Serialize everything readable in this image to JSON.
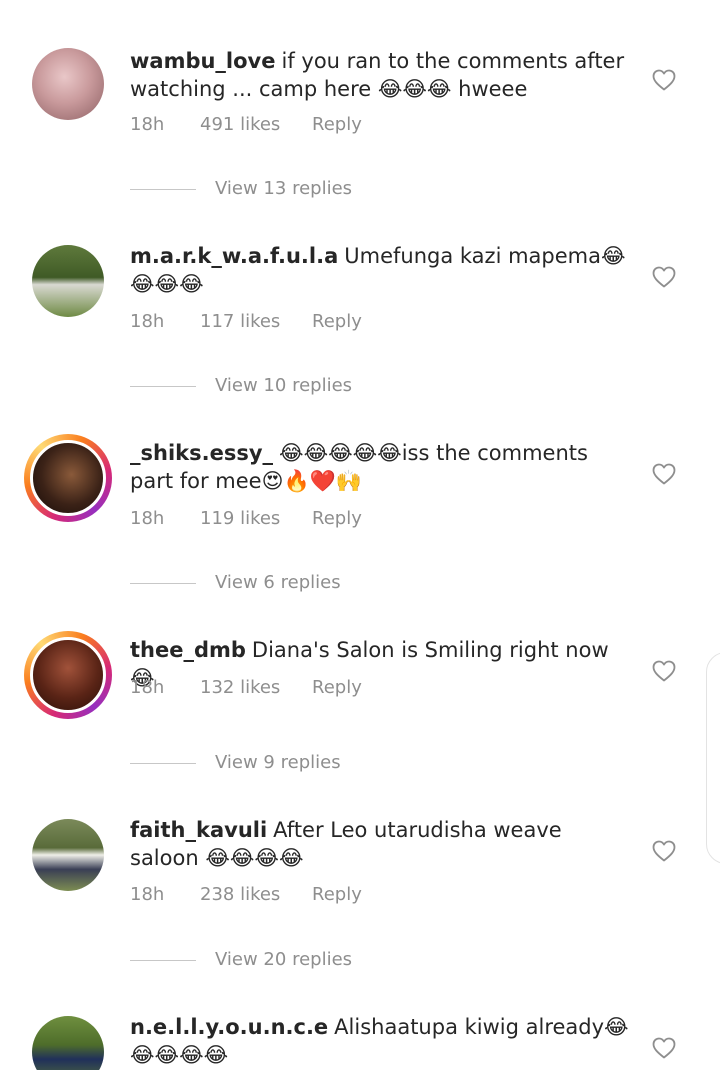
{
  "comments": [
    {
      "username": "wambu_love",
      "text": "if you ran to the comments after watching ... camp here 😂😂😂 hweee",
      "time": "18h",
      "likes": "491 likes",
      "reply_label": "Reply",
      "view_replies": "View 13 replies",
      "avatar_style": "plain"
    },
    {
      "username": "m.a.r.k_w.a.f.u.l.a",
      "text": "Umefunga kazi mapema😂😂😂😂",
      "time": "18h",
      "likes": "117 likes",
      "reply_label": "Reply",
      "view_replies": "View 10 replies",
      "avatar_style": "plain"
    },
    {
      "username": "_shiks.essy_",
      "text": "😂😂😂😂😂iss the comments part for mee😍🔥❤️🙌",
      "time": "18h",
      "likes": "119 likes",
      "reply_label": "Reply",
      "view_replies": "View 6 replies",
      "avatar_style": "story-ring"
    },
    {
      "username": "thee_dmb",
      "text": "Diana's Salon is Smiling right now 😂",
      "time": "18h",
      "likes": "132 likes",
      "reply_label": "Reply",
      "view_replies": "View 9 replies",
      "avatar_style": "story-ring"
    },
    {
      "username": "faith_kavuli",
      "text": "After Leo utarudisha weave saloon 😂😂😂😂",
      "time": "18h",
      "likes": "238 likes",
      "reply_label": "Reply",
      "view_replies": "View 20 replies",
      "avatar_style": "plain"
    },
    {
      "username": "n.e.l.l.y.o.u.n.c.e",
      "text": "Alishaatupa kiwig already😂😂😂😂😂",
      "avatar_style": "plain"
    }
  ],
  "icons": {
    "heart": "heart-outline-icon"
  },
  "colors": {
    "text": "#262626",
    "secondary_text": "#8e8e8e",
    "divider": "#c7c7c7",
    "story_ring_start": "#d62976",
    "story_ring_end": "#fa7e1e"
  }
}
